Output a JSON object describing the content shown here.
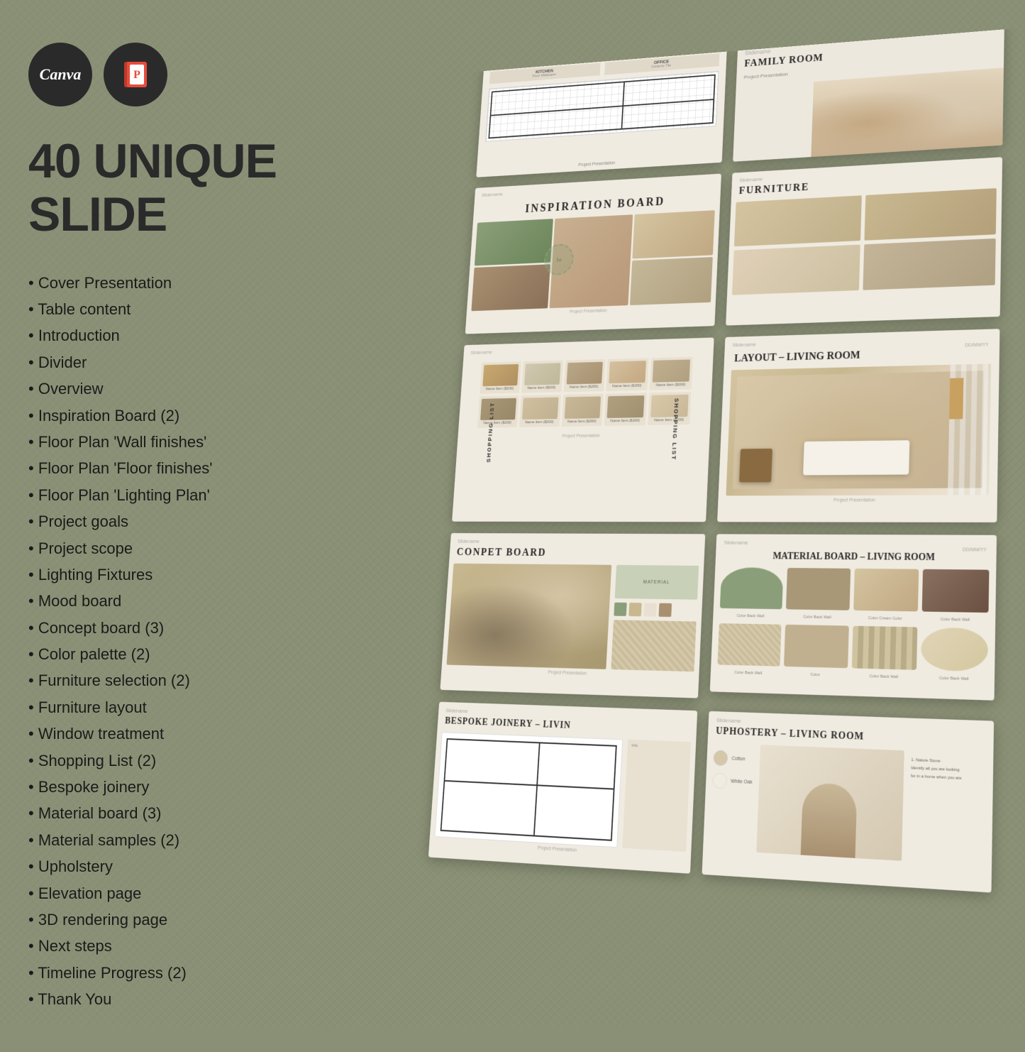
{
  "background": {
    "color": "#8a9075"
  },
  "logos": {
    "canva_label": "Canva",
    "powerpoint_label": "P"
  },
  "main_title": "40 UNIQUE SLIDE",
  "slide_list": {
    "items": [
      {
        "label": "Cover Presentation"
      },
      {
        "label": "Table content"
      },
      {
        "label": "Introduction"
      },
      {
        "label": "Divider"
      },
      {
        "label": "Overview"
      },
      {
        "label": "Inspiration Board (2)"
      },
      {
        "label": "Floor Plan 'Wall finishes'"
      },
      {
        "label": "Floor Plan 'Floor finishes'"
      },
      {
        "label": "Floor Plan 'Lighting Plan'"
      },
      {
        "label": "Project goals"
      },
      {
        "label": "Project scope"
      },
      {
        "label": "Lighting Fixtures"
      },
      {
        "label": "Mood board"
      },
      {
        "label": "Concept board (3)"
      },
      {
        "label": "Color palette (2)"
      },
      {
        "label": "Furniture selection (2)"
      },
      {
        "label": "Furniture layout"
      },
      {
        "label": "Window treatment"
      },
      {
        "label": "Shopping List (2)"
      },
      {
        "label": "Bespoke joinery"
      },
      {
        "label": "Material board (3)"
      },
      {
        "label": "Material samples (2)"
      },
      {
        "label": "Upholstery"
      },
      {
        "label": "Elevation page"
      },
      {
        "label": "3D rendering page"
      },
      {
        "label": "Next steps"
      },
      {
        "label": "Timeline Progress (2)"
      },
      {
        "label": "Thank You"
      }
    ]
  },
  "slides": {
    "floorplan": {
      "footer": "Project Presentation",
      "labels": [
        "KITCHEN",
        "OFFICE"
      ]
    },
    "family_room": {
      "header": "Slidename",
      "title": "FAMILY ROOM",
      "subtitle": "Project Presentation"
    },
    "inspiration": {
      "header": "Slidename",
      "title": "INSPIRATION BOARD",
      "footer": "Project Presentation"
    },
    "furniture": {
      "header": "Slidename",
      "title": "FURNITURE"
    },
    "shopping": {
      "header": "Slidename",
      "label_left": "SHOPPING LIST",
      "label_right": "SHOPPING LIST",
      "footer": "Project Presentation"
    },
    "layout": {
      "header": "Slidename",
      "title": "LAYOUT – ",
      "title_bold": "LIVING ROOM",
      "date": "DD/MM/YY",
      "footer": "Project Presentation"
    },
    "concept": {
      "header": "Slidename",
      "title": "CONPET BOARD",
      "footer": "Project Presentation"
    },
    "material": {
      "header": "Slidename",
      "title": "MATERIAL BOARD – ",
      "title_bold": "LIVING ROOM",
      "date": "DD/MM/YY"
    },
    "bespoke": {
      "header": "Slidename",
      "title": "BESPOKE JOINERY – LIVIN",
      "footer": "Project Presentation"
    },
    "upholstery": {
      "header": "Slidename",
      "title": "UPHOSTERY – LIVING ROOM",
      "dot1": "Cotton",
      "dot2": "White Oak",
      "text1": "1. Nature Stone",
      "text2": "Identify all you are looking",
      "text3": "for in a home when you are"
    }
  }
}
